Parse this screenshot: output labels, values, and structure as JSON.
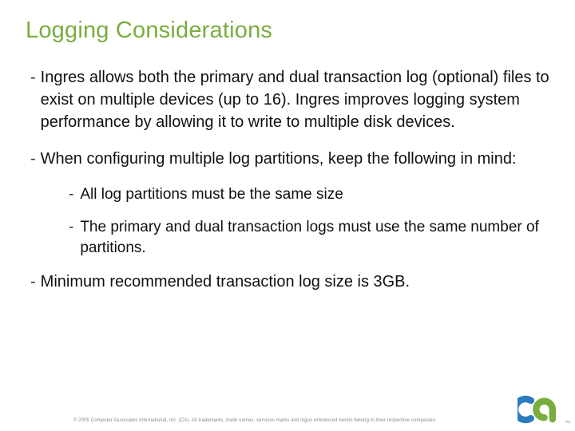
{
  "title": "Logging Considerations",
  "bullets": {
    "b1": "Ingres allows both the primary and dual transaction log (optional) files to exist on multiple devices (up to 16). Ingres improves logging system performance by allowing it to write to multiple disk devices.",
    "b2": "When configuring multiple log partitions, keep the following in mind:",
    "b2a": "All log partitions must be the same size",
    "b2b": "The primary and dual transaction logs must use the same number of partitions.",
    "b3": "Minimum recommended transaction log size is 3GB."
  },
  "footer": "© 2005 Computer Associates International, Inc. (CA). All trademarks, trade names, services marks and logos referenced herein belong to their respective companies.",
  "tm": "™",
  "dash": "-"
}
